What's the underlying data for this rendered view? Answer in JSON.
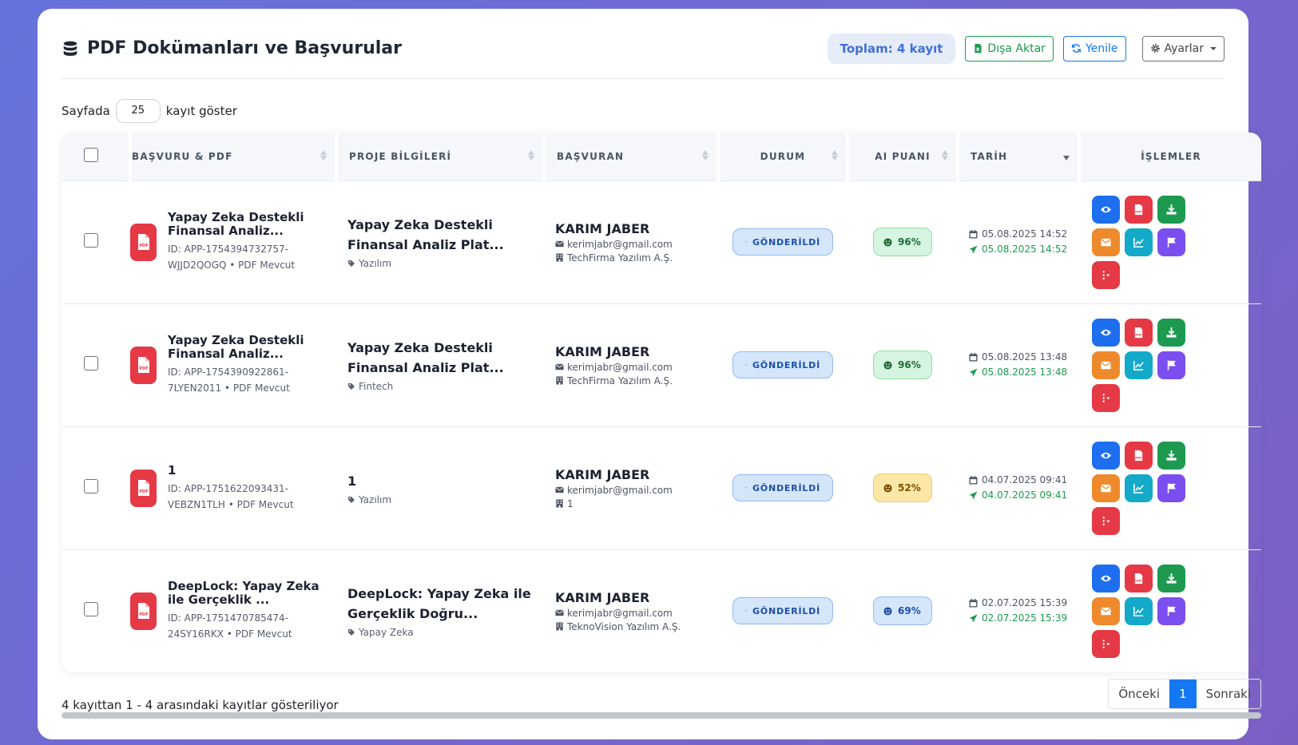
{
  "header": {
    "title": "PDF Dokümanları ve Başvurular",
    "total": "Toplam: 4 kayıt",
    "export_label": "Dışa Aktar",
    "refresh_label": "Yenile",
    "settings_label": "Ayarlar"
  },
  "length": {
    "prefix": "Sayfada",
    "value": "25",
    "suffix": "kayıt göster"
  },
  "columns": [
    "BAŞVURU & PDF",
    "PROJE BİLGİLERİ",
    "BAŞVURAN",
    "DURUM",
    "AI PUANI",
    "TARİH",
    "İŞLEMLER"
  ],
  "rows": [
    {
      "app_title": "Yapay Zeka Destekli Finansal Analiz...",
      "app_id_line1": "ID: APP-1754394732757-",
      "app_id_line2": "WJJD2QOGQ • PDF Mevcut",
      "project_title": "Yapay Zeka Destekli Finansal Analiz Plat...",
      "project_tag": "Yazılım",
      "person": "KARIM JABER",
      "email": "kerimjabr@gmail.com",
      "company": "TechFirma Yazılım A.Ş.",
      "status": "GÖNDERİLDİ",
      "score": "96%",
      "score_level": "green",
      "date_created": "05.08.2025 14:52",
      "date_sent": "05.08.2025 14:52"
    },
    {
      "app_title": "Yapay Zeka Destekli Finansal Analiz...",
      "app_id_line1": "ID: APP-1754390922861-",
      "app_id_line2": "7LYEN2011 • PDF Mevcut",
      "project_title": "Yapay Zeka Destekli Finansal Analiz Plat...",
      "project_tag": "Fintech",
      "person": "KARIM JABER",
      "email": "kerimjabr@gmail.com",
      "company": "TechFirma Yazılım A.Ş.",
      "status": "GÖNDERİLDİ",
      "score": "96%",
      "score_level": "green",
      "date_created": "05.08.2025 13:48",
      "date_sent": "05.08.2025 13:48"
    },
    {
      "app_title": "1",
      "app_id_line1": "ID: APP-1751622093431-",
      "app_id_line2": "VEBZN1TLH • PDF Mevcut",
      "project_title": "1",
      "project_tag": "Yazılım",
      "person": "KARIM JABER",
      "email": "kerimjabr@gmail.com",
      "company": "1",
      "status": "GÖNDERİLDİ",
      "score": "52%",
      "score_level": "yellow",
      "date_created": "04.07.2025 09:41",
      "date_sent": "04.07.2025 09:41"
    },
    {
      "app_title": "DeepLock: Yapay Zeka ile Gerçeklik ...",
      "app_id_line1": "ID: APP-1751470785474-",
      "app_id_line2": "24SY16RKX • PDF Mevcut",
      "project_title": "DeepLock: Yapay Zeka ile Gerçeklik Doğru...",
      "project_tag": "Yapay Zeka",
      "person": "KARIM JABER",
      "email": "kerimjabr@gmail.com",
      "company": "TeknoVision Yazılım A.Ş.",
      "status": "GÖNDERİLDİ",
      "score": "69%",
      "score_level": "blue",
      "date_created": "02.07.2025 15:39",
      "date_sent": "02.07.2025 15:39"
    }
  ],
  "footer": {
    "info": "4 kayıttan 1 - 4 arasındaki kayıtlar gösteriliyor",
    "prev": "Önceki",
    "page": "1",
    "next": "Sonraki"
  },
  "colors": {
    "primary": "#1677f2",
    "success": "#1d9a4f",
    "danger": "#e53945",
    "accent_bg": "#6672dc"
  }
}
